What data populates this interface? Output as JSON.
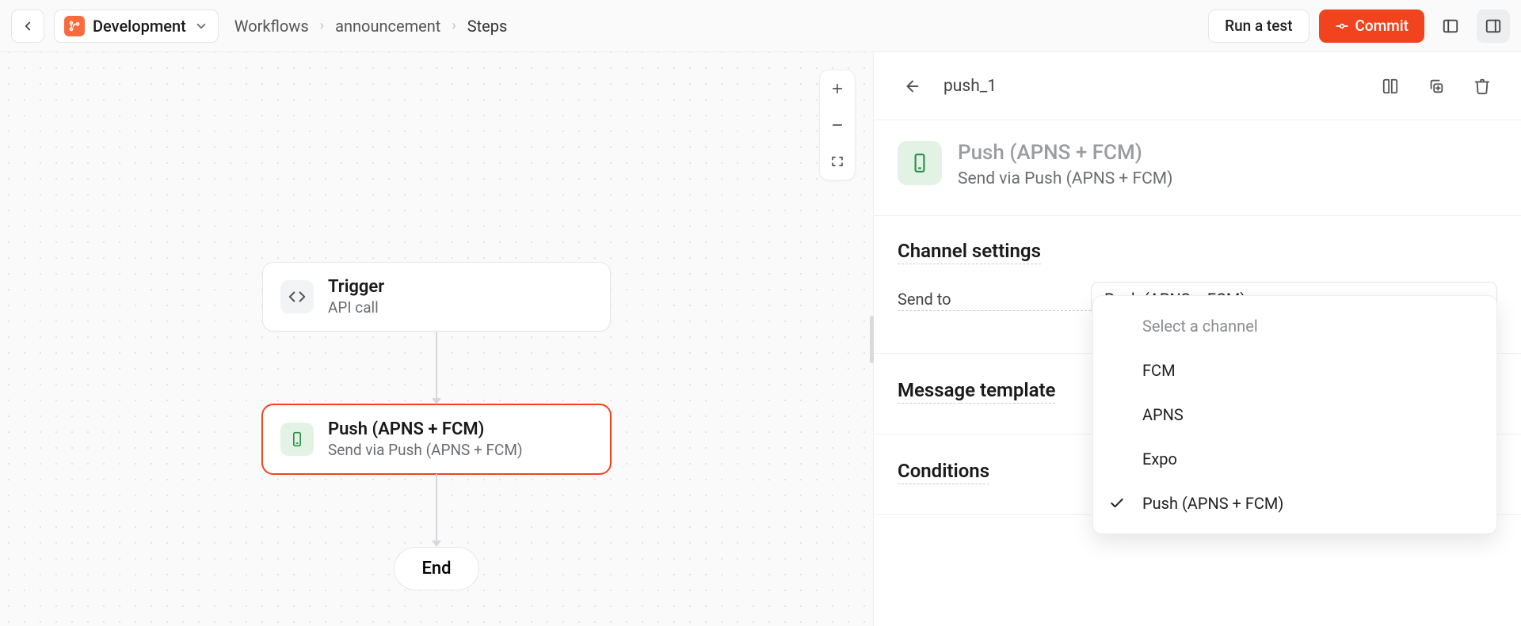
{
  "topbar": {
    "env_label": "Development",
    "breadcrumb": [
      "Workflows",
      "announcement",
      "Steps"
    ],
    "run_test_label": "Run a test",
    "commit_label": "Commit"
  },
  "canvas": {
    "nodes": {
      "trigger": {
        "title": "Trigger",
        "subtitle": "API call"
      },
      "push": {
        "title": "Push (APNS + FCM)",
        "subtitle": "Send via Push (APNS + FCM)"
      }
    },
    "end_label": "End"
  },
  "panel": {
    "step_key": "push_1",
    "hero_title": "Push (APNS + FCM)",
    "hero_subtitle": "Send via Push (APNS + FCM)",
    "sections": {
      "channel_settings_title": "Channel settings",
      "send_to_label": "Send to",
      "send_to_value": "Push (APNS + FCM)",
      "message_template_title": "Message template",
      "conditions_title": "Conditions"
    },
    "dropdown": {
      "placeholder": "Select a channel",
      "options": [
        "FCM",
        "APNS",
        "Expo",
        "Push (APNS + FCM)"
      ],
      "selected": "Push (APNS + FCM)"
    }
  }
}
